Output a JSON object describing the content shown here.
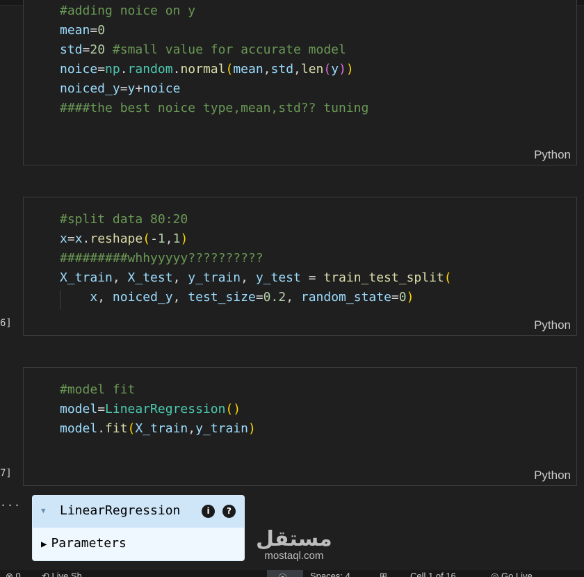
{
  "cells": [
    {
      "language": "Python",
      "execution_count": "",
      "lines": [
        [
          {
            "t": "#adding noice on y",
            "c": "c"
          }
        ],
        [
          {
            "t": "mean",
            "c": "v"
          },
          {
            "t": "=",
            "c": "o"
          },
          {
            "t": "0",
            "c": "n"
          }
        ],
        [
          {
            "t": "std",
            "c": "v"
          },
          {
            "t": "=",
            "c": "o"
          },
          {
            "t": "20",
            "c": "n"
          },
          {
            "t": " ",
            "c": "o"
          },
          {
            "t": "#small value for accurate model",
            "c": "c"
          }
        ],
        [
          {
            "t": "noice",
            "c": "v"
          },
          {
            "t": "=",
            "c": "o"
          },
          {
            "t": "np",
            "c": "cls"
          },
          {
            "t": ".",
            "c": "o"
          },
          {
            "t": "random",
            "c": "cls"
          },
          {
            "t": ".",
            "c": "o"
          },
          {
            "t": "normal",
            "c": "f"
          },
          {
            "t": "(",
            "c": "b1"
          },
          {
            "t": "mean",
            "c": "v"
          },
          {
            "t": ",",
            "c": "o"
          },
          {
            "t": "std",
            "c": "v"
          },
          {
            "t": ",",
            "c": "o"
          },
          {
            "t": "len",
            "c": "f"
          },
          {
            "t": "(",
            "c": "b2"
          },
          {
            "t": "y",
            "c": "v"
          },
          {
            "t": ")",
            "c": "b2"
          },
          {
            "t": ")",
            "c": "b1"
          }
        ],
        [
          {
            "t": "noiced_y",
            "c": "v"
          },
          {
            "t": "=",
            "c": "o"
          },
          {
            "t": "y",
            "c": "v"
          },
          {
            "t": "+",
            "c": "o"
          },
          {
            "t": "noice",
            "c": "v"
          }
        ],
        [
          {
            "t": "####the best noice type,mean,std?? tuning",
            "c": "c"
          }
        ]
      ]
    },
    {
      "language": "Python",
      "execution_count": "6]",
      "lines": [
        [
          {
            "t": "#split data 80:20",
            "c": "c"
          }
        ],
        [
          {
            "t": "x",
            "c": "v"
          },
          {
            "t": "=",
            "c": "o"
          },
          {
            "t": "x",
            "c": "v"
          },
          {
            "t": ".",
            "c": "o"
          },
          {
            "t": "reshape",
            "c": "f"
          },
          {
            "t": "(",
            "c": "b1"
          },
          {
            "t": "-",
            "c": "o"
          },
          {
            "t": "1",
            "c": "n"
          },
          {
            "t": ",",
            "c": "o"
          },
          {
            "t": "1",
            "c": "n"
          },
          {
            "t": ")",
            "c": "b1"
          }
        ],
        [
          {
            "t": "#########whhyyyyy??????????",
            "c": "c"
          }
        ],
        [
          {
            "t": "X_train",
            "c": "v"
          },
          {
            "t": ", ",
            "c": "o"
          },
          {
            "t": "X_test",
            "c": "v"
          },
          {
            "t": ", ",
            "c": "o"
          },
          {
            "t": "y_train",
            "c": "v"
          },
          {
            "t": ", ",
            "c": "o"
          },
          {
            "t": "y_test",
            "c": "v"
          },
          {
            "t": " = ",
            "c": "o"
          },
          {
            "t": "train_test_split",
            "c": "f"
          },
          {
            "t": "(",
            "c": "b1"
          }
        ],
        [
          {
            "t": "    ",
            "c": "o",
            "guide": true
          },
          {
            "t": "x",
            "c": "v"
          },
          {
            "t": ", ",
            "c": "o"
          },
          {
            "t": "noiced_y",
            "c": "v"
          },
          {
            "t": ", ",
            "c": "o"
          },
          {
            "t": "test_size",
            "c": "v"
          },
          {
            "t": "=",
            "c": "o"
          },
          {
            "t": "0.2",
            "c": "n"
          },
          {
            "t": ", ",
            "c": "o"
          },
          {
            "t": "random_state",
            "c": "v"
          },
          {
            "t": "=",
            "c": "o"
          },
          {
            "t": "0",
            "c": "n"
          },
          {
            "t": ")",
            "c": "b1"
          }
        ]
      ]
    },
    {
      "language": "Python",
      "execution_count": "7]",
      "lines": [
        [
          {
            "t": "#model fit",
            "c": "c"
          }
        ],
        [
          {
            "t": "model",
            "c": "v"
          },
          {
            "t": "=",
            "c": "o"
          },
          {
            "t": "LinearRegression",
            "c": "cls"
          },
          {
            "t": "(",
            "c": "b1"
          },
          {
            "t": ")",
            "c": "b1"
          }
        ],
        [
          {
            "t": "model",
            "c": "v"
          },
          {
            "t": ".",
            "c": "o"
          },
          {
            "t": "fit",
            "c": "f"
          },
          {
            "t": "(",
            "c": "b1"
          },
          {
            "t": "X_train",
            "c": "v"
          },
          {
            "t": ",",
            "c": "o"
          },
          {
            "t": "y_train",
            "c": "v"
          },
          {
            "t": ")",
            "c": "b1"
          }
        ]
      ]
    }
  ],
  "output": {
    "ellipsis": "...",
    "widget_title": "LinearRegression",
    "info_icon": "i",
    "help_icon": "?",
    "parameters_label": "Parameters"
  },
  "watermark": {
    "arabic": "مستقل",
    "latin": "mostaql.com"
  },
  "statusbar": {
    "items": [
      "⊗ 0",
      "⟲ Live Sh...",
      "⦿",
      "Spaces: 4",
      "⊞",
      "Cell 1 of 16",
      "◎ Go Live"
    ]
  }
}
